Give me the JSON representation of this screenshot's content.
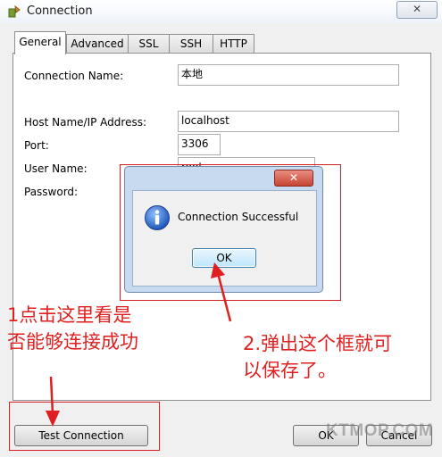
{
  "window": {
    "title": "Connection",
    "close_glyph": "✕"
  },
  "tabs": [
    {
      "label": "General",
      "active": true
    },
    {
      "label": "Advanced",
      "active": false
    },
    {
      "label": "SSL",
      "active": false
    },
    {
      "label": "SSH",
      "active": false
    },
    {
      "label": "HTTP",
      "active": false
    }
  ],
  "form": {
    "connection_name": {
      "label": "Connection Name:",
      "value": "本地"
    },
    "host": {
      "label": "Host Name/IP Address:",
      "value": "localhost"
    },
    "port": {
      "label": "Port:",
      "value": "3306"
    },
    "user": {
      "label": "User Name:",
      "value": "root"
    },
    "password": {
      "label": "Password:",
      "value": "•••••"
    }
  },
  "dialog": {
    "message": "Connection Successful",
    "ok_label": "OK",
    "close_glyph": "✕",
    "icon": "info-icon"
  },
  "buttons": {
    "test_connection": "Test Connection",
    "ok": "OK",
    "cancel": "Cancel"
  },
  "annotations": {
    "left_line1": "1点击这里看是",
    "left_line2": "否能够连接成功",
    "right_line1": "2.弹出这个框就可",
    "right_line2": "以保存了。"
  },
  "watermark": "KTMOP.COM",
  "colors": {
    "annotation_red": "#e02020",
    "info_blue": "#2f6fd0"
  }
}
